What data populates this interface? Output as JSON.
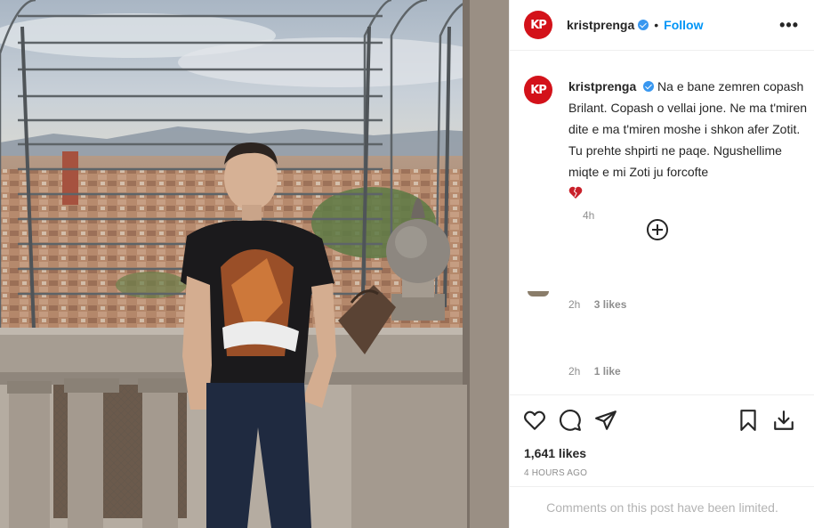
{
  "post": {
    "username": "kristprenga",
    "follow_label": "Follow",
    "dot": "•",
    "more_label": "•••",
    "avatar_text": "KP"
  },
  "caption": {
    "username": "kristprenga",
    "text": "Na e bane zemren copash Brilant. Copash o vellai jone. Ne ma t'miren dite e ma t'miren moshe i shkon afer Zotit. Tu prehte shpirti ne paqe. Ngushellime miqte e mi Zoti ju forcofte",
    "time": "4h"
  },
  "comments_meta": [
    {
      "time": "2h",
      "likes": "3 likes"
    },
    {
      "time": "2h",
      "likes": "1 like"
    }
  ],
  "actions": {
    "likes": "1,641 likes",
    "time_ago": "4 HOURS AGO",
    "limited": "Comments on this post have been limited."
  },
  "colors": {
    "accent": "#0095f6",
    "verified": "#3897f0",
    "avatar_bg": "#d3121a",
    "muted": "#8e8e8e"
  },
  "icons": [
    "verified-badge-icon",
    "more-options-icon",
    "load-more-comments-icon",
    "heart-icon",
    "comment-icon",
    "share-icon",
    "save-icon",
    "download-icon"
  ]
}
